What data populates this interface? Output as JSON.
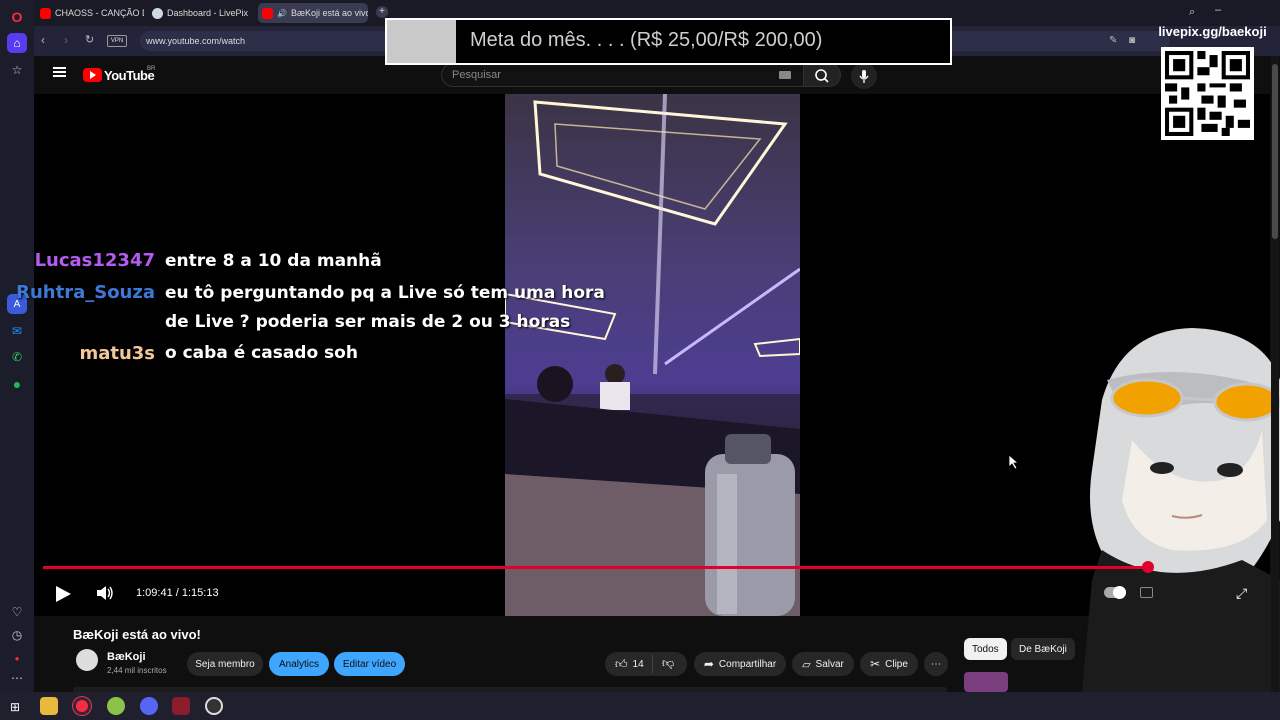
{
  "browser": {
    "tabs": [
      {
        "label": "CHAOSS - CANÇÃO DA P",
        "favicon": "youtube-icon"
      },
      {
        "label": "Dashboard - LivePix",
        "favicon": "livepix-icon"
      },
      {
        "label": "BæKoji está ao vivo!",
        "favicon": "youtube-icon"
      }
    ],
    "url": "www.youtube.com/watch",
    "vpn_label": "VPN"
  },
  "youtube": {
    "logo": "YouTube",
    "region": "BR",
    "search_placeholder": "Pesquisar"
  },
  "overlay": {
    "goal_text": "Meta do mês. . . . (R$ 25,00/R$ 200,00)",
    "livepix_url": "livepix.gg/baekoji"
  },
  "chat": [
    {
      "user": "Lucas12347",
      "color": "#b45cf0",
      "lines": [
        "entre 8 a 10 da manhã"
      ]
    },
    {
      "user": "Ruhtra_Souza",
      "color": "#3d79d6",
      "lines": [
        "eu tô perguntando pq a Live só tem uma hora",
        "de Live ? poderia ser mais de 2 ou 3 horas"
      ]
    },
    {
      "user": "matu3s",
      "color": "#f2c89a",
      "lines": [
        "o caba é casado soh"
      ]
    }
  ],
  "player": {
    "time_current": "1:09:41",
    "time_separator": "/",
    "time_total": "1:15:13",
    "time_display": "1:09:41 / 1:15:13",
    "progress_fraction": 0.927
  },
  "video_info": {
    "title": "BæKoji está ao vivo!",
    "channel": "BæKoji",
    "subscribers": "2,44 mil inscritos",
    "join_label": "Seja membro",
    "analytics_label": "Analytics",
    "edit_label": "Editar vídeo",
    "likes": "14",
    "share_label": "Compartilhar",
    "save_label": "Salvar",
    "clip_label": "Clipe"
  },
  "filters": [
    {
      "label": "Todos"
    },
    {
      "label": "De BæKoji"
    }
  ],
  "colors": {
    "accent_red": "#e1002d",
    "blue_button": "#3ea6ff",
    "sidebar": "#1c1d2a"
  }
}
